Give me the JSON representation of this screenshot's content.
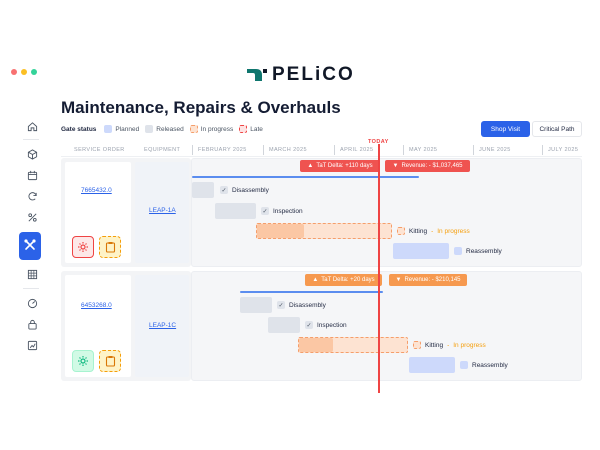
{
  "window_dots": [
    "#f87171",
    "#fbbf24",
    "#34d399"
  ],
  "brand": {
    "name": "PELiCO",
    "color": "#0f766e"
  },
  "sidebar": {
    "items": [
      {
        "icon": "home-icon"
      },
      {
        "icon": "cube-icon"
      },
      {
        "icon": "calendar-icon"
      },
      {
        "icon": "refresh-icon"
      },
      {
        "icon": "tools-icon",
        "active": true
      },
      {
        "icon": "table-icon"
      },
      {
        "icon": "gauge-icon"
      },
      {
        "icon": "lock-icon"
      },
      {
        "icon": "chart-icon"
      }
    ]
  },
  "page_title": "Maintenance, Repairs & Overhauls",
  "gate_status": {
    "label": "Gate status",
    "items": [
      {
        "label": "Planned",
        "color": "#cdd9fb"
      },
      {
        "label": "Released",
        "color": "#dfe3ea"
      },
      {
        "label": "In progress",
        "color": "#fde3d2"
      },
      {
        "label": "Late",
        "color": "#fca5a5"
      }
    ]
  },
  "view_buttons": {
    "shop_visit": "Shop Visit",
    "critical_path": "Critical Path"
  },
  "columns": {
    "service_order": "SERVICE ORDER",
    "equipment": "EQUIPMENT"
  },
  "months": [
    "FEBRUARY 2025",
    "MARCH 2025",
    "APRIL 2025",
    "MAY 2025",
    "JUNE 2025",
    "JULY 2025"
  ],
  "today_label": "TODAY",
  "rows": [
    {
      "service_order": "7665432.0",
      "equipment": "LEAP-1A",
      "tat_tag": "TaT Delta: +110 days",
      "revenue_tag": "Revenue: - $1,037,465",
      "tag_color": "red",
      "tasks": [
        "Disassembly",
        "Inspection",
        "Kitting",
        "Reassembly"
      ],
      "kitting_status": "In progress"
    },
    {
      "service_order": "6453268.0",
      "equipment": "LEAP-1C",
      "tat_tag": "TaT Delta: +20 days",
      "revenue_tag": "Revenue: - $210,145",
      "tag_color": "orange",
      "tasks": [
        "Disassembly",
        "Inspection",
        "Kitting",
        "Reassembly"
      ],
      "kitting_status": "In progress"
    }
  ]
}
